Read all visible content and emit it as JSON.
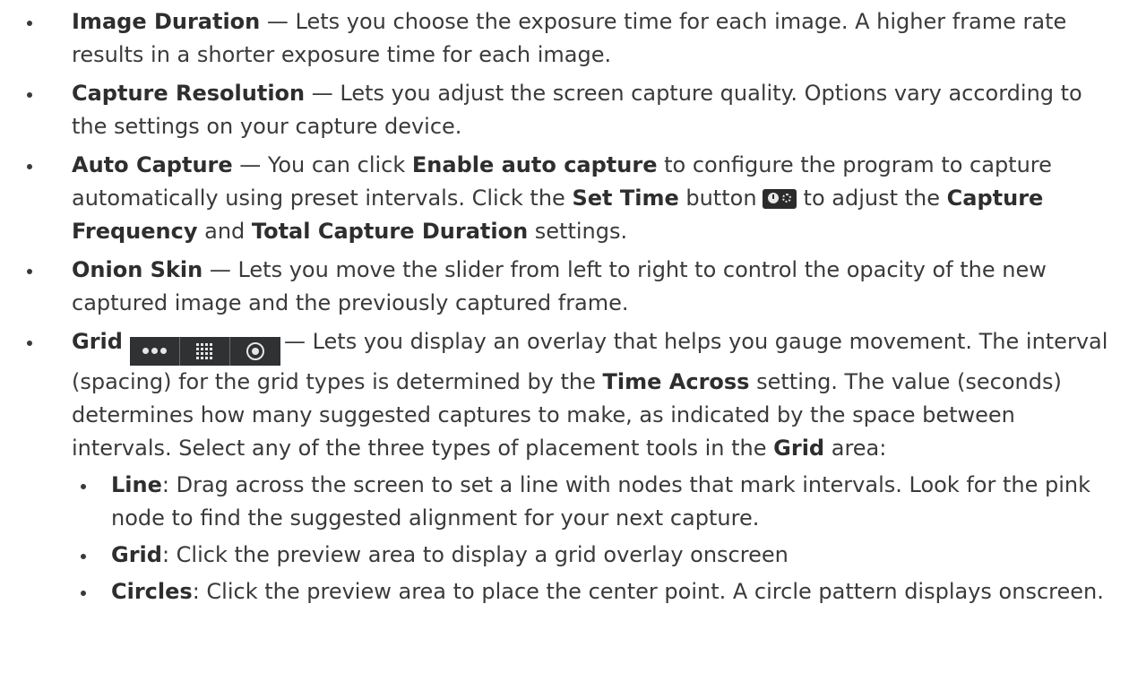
{
  "items": [
    {
      "term": "Image Duration",
      "text": " — Lets you choose the exposure time for each image. A higher frame rate results in a shorter exposure time for each image."
    },
    {
      "term": "Capture Resolution",
      "text": " — Lets you adjust the screen capture quality. Options vary according to the settings on your capture device."
    },
    {
      "term": "Auto Capture",
      "t1": " — You can click ",
      "b1": "Enable auto capture",
      "t2": " to configure the program to capture automatically using preset intervals. Click the ",
      "b2": "Set Time",
      "t3": " button",
      "t4": "to adjust the ",
      "b3": "Capture Frequency",
      "t5": " and ",
      "b4": "Total Capture Duration",
      "t6": " settings."
    },
    {
      "term": "Onion Skin",
      "text": " — Lets you move the slider from left to right to control the opacity of the new captured image and the previously captured frame."
    },
    {
      "term": "Grid",
      "t1": "— Lets you display an overlay that helps you gauge movement. The interval (spacing) for the grid types is determined by the ",
      "b1": "Time Across",
      "t2": " setting. The value (seconds) determines how many suggested captures to make, as indicated by the space between intervals. Select any of the three types of placement tools in the ",
      "b2": "Grid",
      "t3": " area:",
      "icons": [
        "dots-icon",
        "grid-icon",
        "circle-target-icon"
      ],
      "sub": [
        {
          "term": "Line",
          "text": ": Drag across the screen to set a line with nodes that mark intervals. Look for the pink node to find the suggested alignment for your next capture."
        },
        {
          "term": "Grid",
          "text": ": Click the preview area to display a grid overlay onscreen"
        },
        {
          "term": "Circles",
          "text": ": Click the preview area to place the center point. A circle pattern displays onscreen."
        }
      ]
    }
  ],
  "set_time_icon": "clock-gear-icon",
  "icon_bg_color": "#2f3133",
  "icon_fg_color": "#e6e6e6"
}
